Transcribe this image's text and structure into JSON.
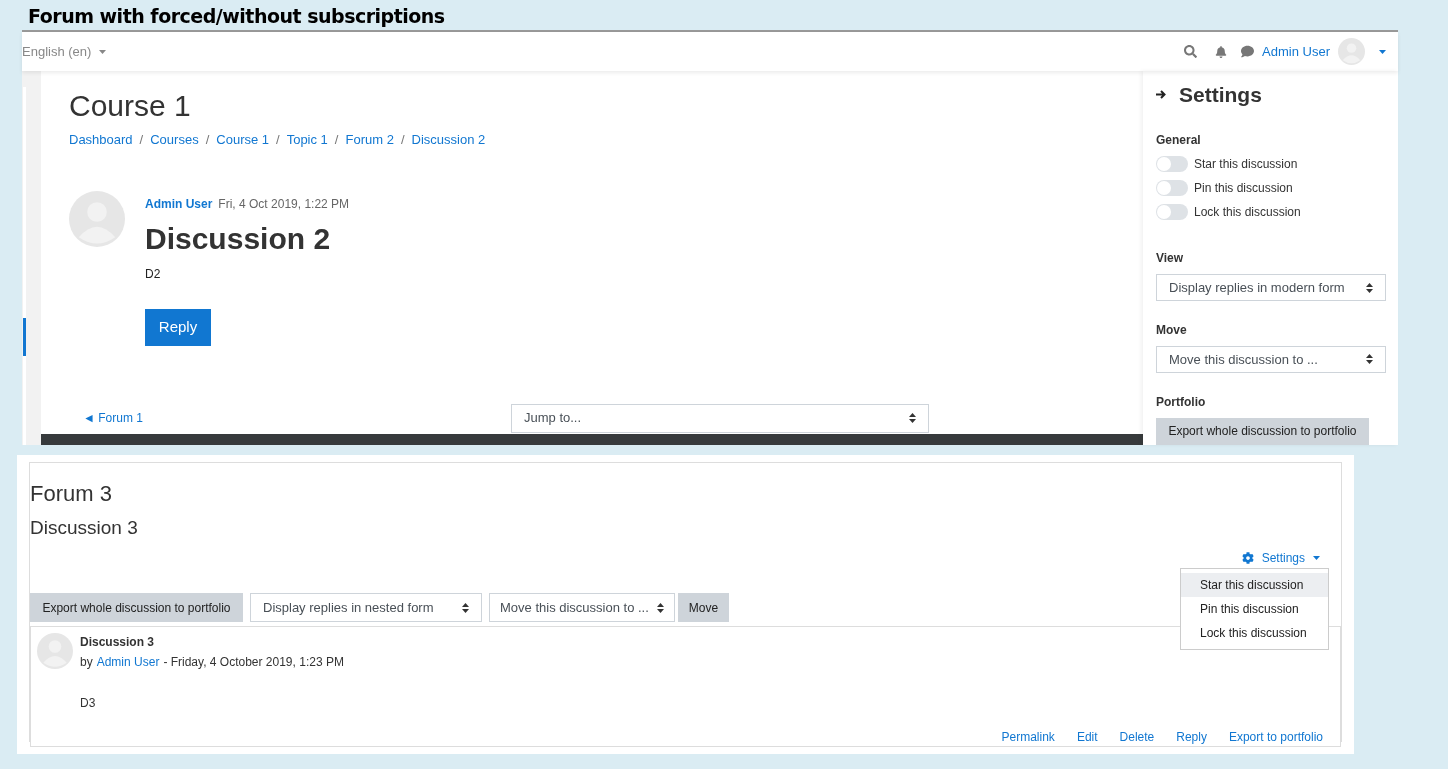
{
  "caption": "Forum with forced/without subscriptions",
  "top": {
    "navbar": {
      "language": "English (en)",
      "user": "Admin User"
    },
    "page_title": "Course 1",
    "breadcrumbs": [
      "Dashboard",
      "Courses",
      "Course 1",
      "Topic 1",
      "Forum 2",
      "Discussion 2"
    ],
    "breadcrumb_separator": "/",
    "post": {
      "author": "Admin User",
      "date": "Fri, 4 Oct 2019, 1:22 PM",
      "title": "Discussion 2",
      "body": "D2",
      "reply_button": "Reply"
    },
    "prev_link": "◄ Forum 1",
    "jump_select": "Jump to...",
    "settings": {
      "title": "Settings",
      "general_label": "General",
      "toggles": [
        {
          "label": "Star this discussion",
          "checked": false
        },
        {
          "label": "Pin this discussion",
          "checked": false
        },
        {
          "label": "Lock this discussion",
          "checked": false
        }
      ],
      "view_label": "View",
      "view_select": "Display replies in modern form",
      "move_label": "Move",
      "move_select": "Move this discussion to ...",
      "portfolio_label": "Portfolio",
      "portfolio_button": "Export whole discussion to portfolio"
    }
  },
  "bottom": {
    "forum_title": "Forum 3",
    "discussion_title": "Discussion 3",
    "settings_menu": {
      "label": "Settings",
      "items": [
        {
          "label": "Star this discussion",
          "selected": true
        },
        {
          "label": "Pin this discussion",
          "selected": false
        },
        {
          "label": "Lock this discussion",
          "selected": false
        }
      ]
    },
    "toolbar": {
      "export_button": "Export whole discussion to portfolio",
      "view_select": "Display replies in nested form",
      "move_select": "Move this discussion to ...",
      "move_button": "Move"
    },
    "post": {
      "title": "Discussion 3",
      "by": "by",
      "author": "Admin User",
      "date": "- Friday, 4 October 2019, 1:23 PM",
      "body": "D3",
      "actions": [
        "Permalink",
        "Edit",
        "Delete",
        "Reply",
        "Export to portfolio"
      ]
    }
  }
}
